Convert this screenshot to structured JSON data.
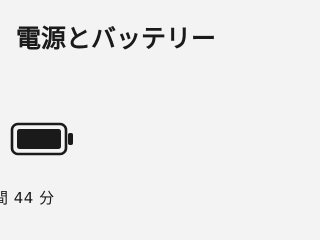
{
  "header": {
    "title": "電源とバッテリー"
  },
  "battery": {
    "icon": "battery-full-icon",
    "level_fraction": 1.0,
    "remaining_text": "間 44 分"
  },
  "colors": {
    "background": "#f3f3f3",
    "text": "#1a1a1a",
    "battery_fill": "#1a1a1a"
  }
}
